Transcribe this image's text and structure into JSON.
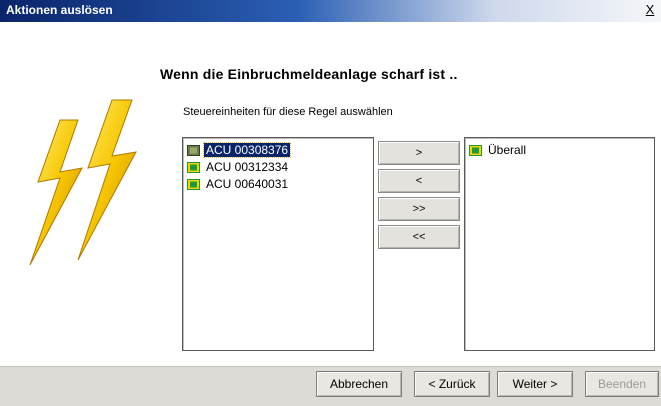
{
  "window": {
    "title": "Aktionen auslösen",
    "close_label": "X"
  },
  "heading": "Wenn die Einbruchmeldeanlage scharf ist ..",
  "instruction": "Steuereinheiten für diese Regel auswählen",
  "available_units": [
    {
      "label": "ACU 00308376",
      "selected": true
    },
    {
      "label": "ACU 00312334",
      "selected": false
    },
    {
      "label": "ACU 00640031",
      "selected": false
    }
  ],
  "selected_units": [
    {
      "label": "Überall"
    }
  ],
  "move_buttons": {
    "add": ">",
    "remove": "<",
    "add_all": ">>",
    "remove_all": "<<"
  },
  "footer": {
    "cancel": "Abbrechen",
    "back": "< Zurück",
    "next": "Weiter >",
    "finish": "Beenden"
  },
  "colors": {
    "titlebar": "#0a246a",
    "selection": "#0a246a",
    "icon_yellow": "#f2d400",
    "icon_green": "#1f9a3a",
    "bolt": "#f7c600"
  }
}
